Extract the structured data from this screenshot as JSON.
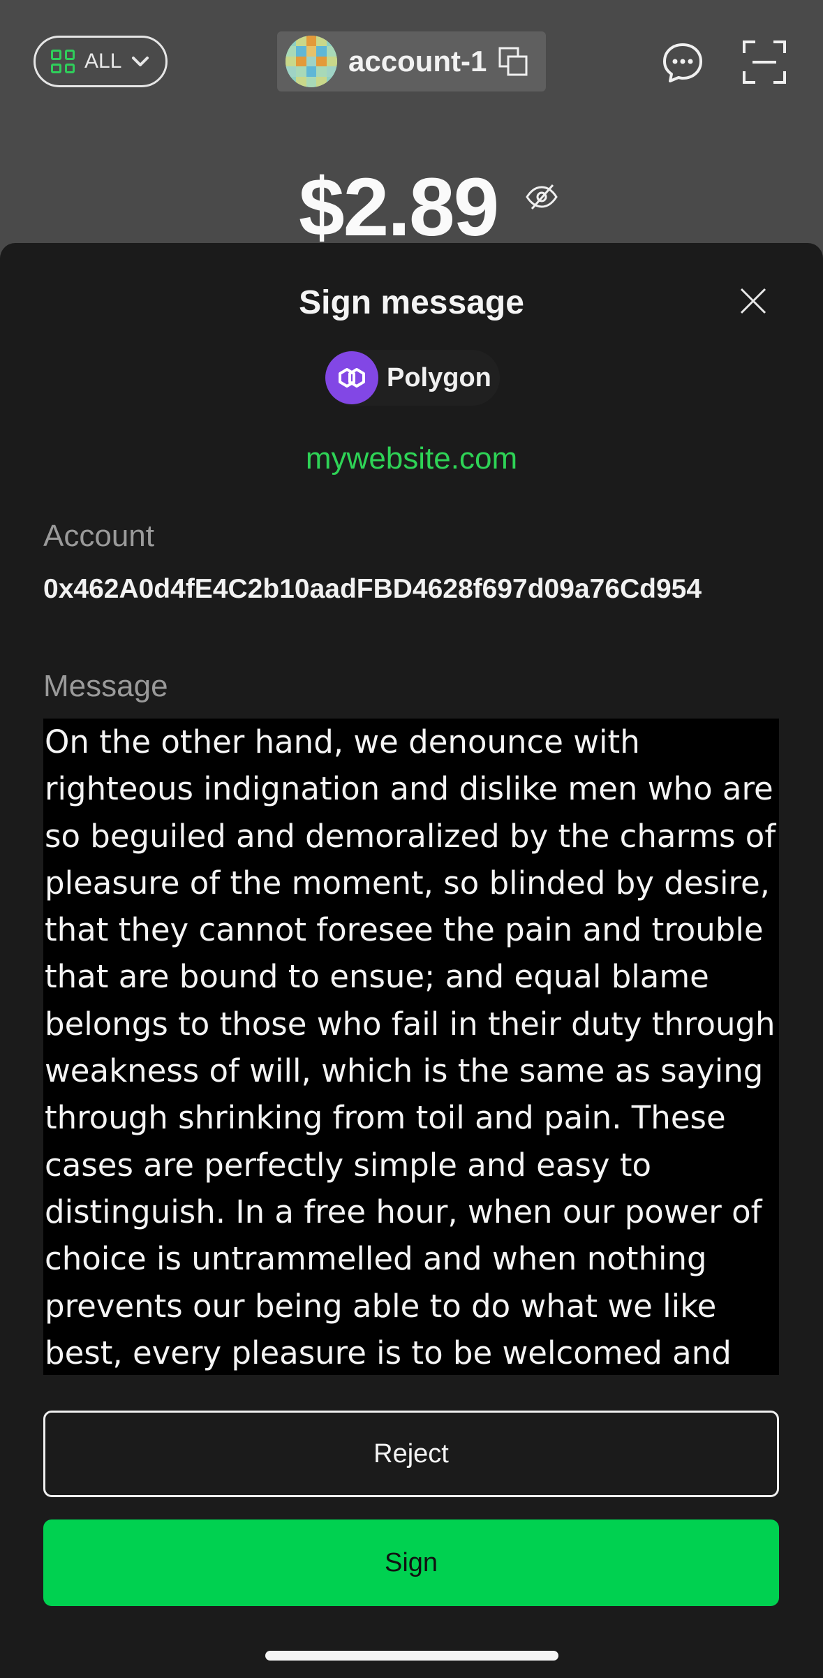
{
  "header": {
    "network_filter_label": "ALL",
    "account_name": "account-1",
    "balance": "$2.89"
  },
  "icons": {
    "network_filter": "grid-icon",
    "dropdown": "chevron-down-icon",
    "copy": "copy-icon",
    "chat": "chat-bubble-icon",
    "scan": "scan-icon",
    "hide_balance": "eye-off-icon",
    "close": "close-icon",
    "chain": "polygon-logo-icon"
  },
  "colors": {
    "accent_green": "#00d150",
    "site_green": "#2ed356",
    "polygon_purple": "#8247e5",
    "sheet_bg": "#1b1b1b",
    "backdrop": "#4a4a4a"
  },
  "modal": {
    "title": "Sign message",
    "chain_name": "Polygon",
    "site": "mywebsite.com",
    "account_label": "Account",
    "account_address": "0x462A0d4fE4C2b10aadFBD4628f697d09a76Cd954",
    "message_label": "Message",
    "message_lines": [
      "On the other hand, we denounce with",
      "righteous indignation and dislike men who are",
      "so beguiled and demoralized by the charms of",
      "pleasure of the moment, so blinded by desire,",
      "that they cannot foresee the pain and trouble",
      "that are bound to ensue; and equal blame",
      "belongs to those who fail in their duty through",
      "weakness of will, which is the same as saying",
      "through shrinking from toil and pain. These",
      "cases are perfectly simple and easy to",
      "distinguish. In a free hour, when our power of",
      "choice is untrammelled and when nothing",
      "prevents our being able to do what we like",
      "best, every pleasure is to be welcomed and"
    ],
    "reject_label": "Reject",
    "sign_label": "Sign"
  }
}
